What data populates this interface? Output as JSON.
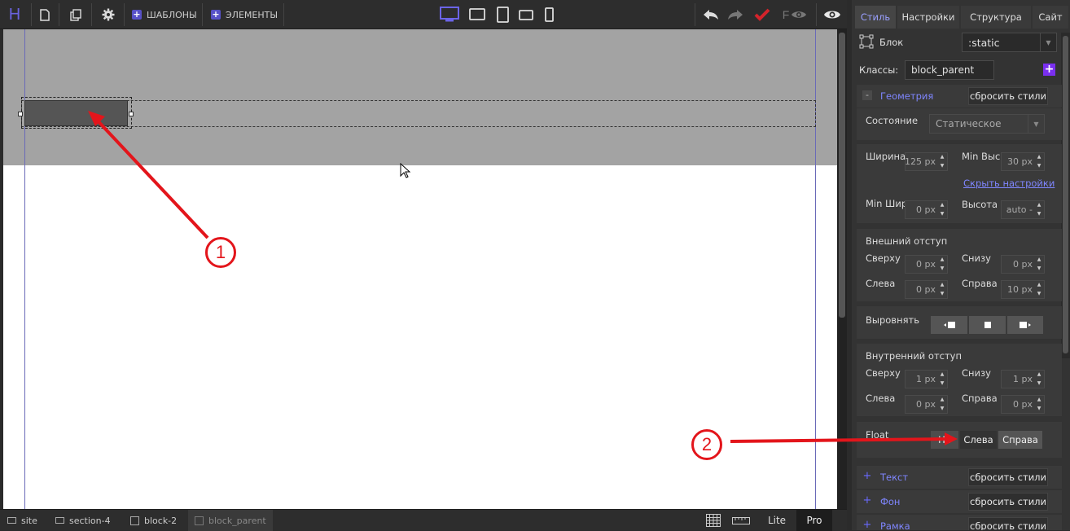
{
  "topbar": {
    "logo": "H",
    "templates_label": "ШАБЛОНЫ",
    "elements_label": "ЭЛЕМЕНТЫ",
    "preview_letter": "F",
    "icons": [
      "new-page-icon",
      "copy-icon",
      "gear-icon",
      "desktop-icon",
      "tablet-landscape-icon",
      "tablet-portrait-icon",
      "phone-landscape-icon",
      "phone-portrait-icon",
      "undo-icon",
      "redo-icon",
      "publish-check-icon",
      "hide-eye-icon",
      "preview-eye-icon"
    ]
  },
  "breadcrumbs": [
    {
      "label": "site"
    },
    {
      "label": "section-4"
    },
    {
      "label": "block-2"
    },
    {
      "label": "block_parent"
    }
  ],
  "bottom_right": {
    "lite": "Lite",
    "pro": "Pro"
  },
  "panel": {
    "tabs": [
      "Стиль",
      "Настройки",
      "Структура",
      "Сайт"
    ],
    "block_label": "Блок",
    "position_value": ":static",
    "classes_label": "Классы:",
    "classes_value": "block_parent",
    "geometry": {
      "title": "Геометрия",
      "reset": "сбросить стили",
      "state_label": "Состояние",
      "state_value": "Статическое",
      "width_label": "Ширина",
      "width_value": "125",
      "min_height_label": "Min Высота",
      "min_height_value": "30",
      "hide_settings": "Скрыть настройки",
      "min_width_label": "Min Ширина",
      "min_width_value": "0",
      "height_label": "Высота",
      "height_value": "auto",
      "unit": "px",
      "height_unit": "-",
      "margin_title": "Внешний отступ",
      "margin_top_label": "Сверху",
      "margin_top": "0",
      "margin_bottom_label": "Снизу",
      "margin_bottom": "0",
      "margin_left_label": "Слева",
      "margin_left": "0",
      "margin_right_label": "Справа",
      "margin_right": "10",
      "align_label": "Выровнять",
      "padding_title": "Внутренний отступ",
      "padding_top_label": "Сверху",
      "padding_top": "1",
      "padding_bottom_label": "Снизу",
      "padding_bottom": "1",
      "padding_left_label": "Слева",
      "padding_left": "0",
      "padding_right_label": "Справа",
      "padding_right": "0",
      "float_label": "Float",
      "float_none": "Не",
      "float_left": "Слева",
      "float_right": "Справа"
    },
    "text_section": {
      "title": "Текст",
      "reset": "сбросить стили"
    },
    "bg_section": {
      "title": "Фон",
      "reset": "сбросить стили"
    },
    "border_section": {
      "title": "Рамка",
      "reset": "сбросить стили"
    }
  },
  "annotations": {
    "one": "1",
    "two": "2"
  },
  "colors": {
    "accent": "#5751c7",
    "arrow": "#e3151b",
    "tab_active": "#9aa0ff"
  }
}
